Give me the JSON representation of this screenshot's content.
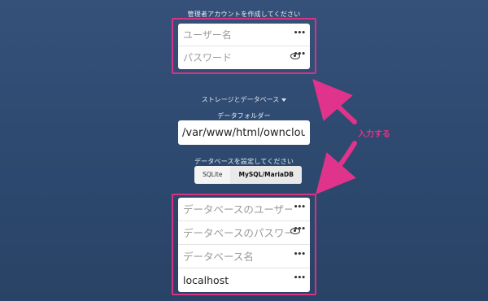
{
  "admin": {
    "heading": "管理者アカウントを作成してください",
    "username_placeholder": "ユーザー名",
    "password_placeholder": "パスワード"
  },
  "storage": {
    "link_label": "ストレージとデータベース",
    "folder_label": "データフォルダー",
    "folder_value": "/var/www/html/owncloud/data"
  },
  "database": {
    "heading": "データベースを設定してください",
    "tabs": [
      {
        "label": "SQLite",
        "active": false
      },
      {
        "label": "MySQL/MariaDB",
        "active": true
      }
    ],
    "user_placeholder": "データベースのユーザー名",
    "password_placeholder": "データベースのパスワード",
    "name_placeholder": "データベース名",
    "host_value": "localhost"
  },
  "annotation": {
    "label": "入力する",
    "color": "#e0338b"
  },
  "icons": {
    "more": "dots-icon",
    "show_password": "eye-icon",
    "dropdown": "caret-down-icon"
  }
}
